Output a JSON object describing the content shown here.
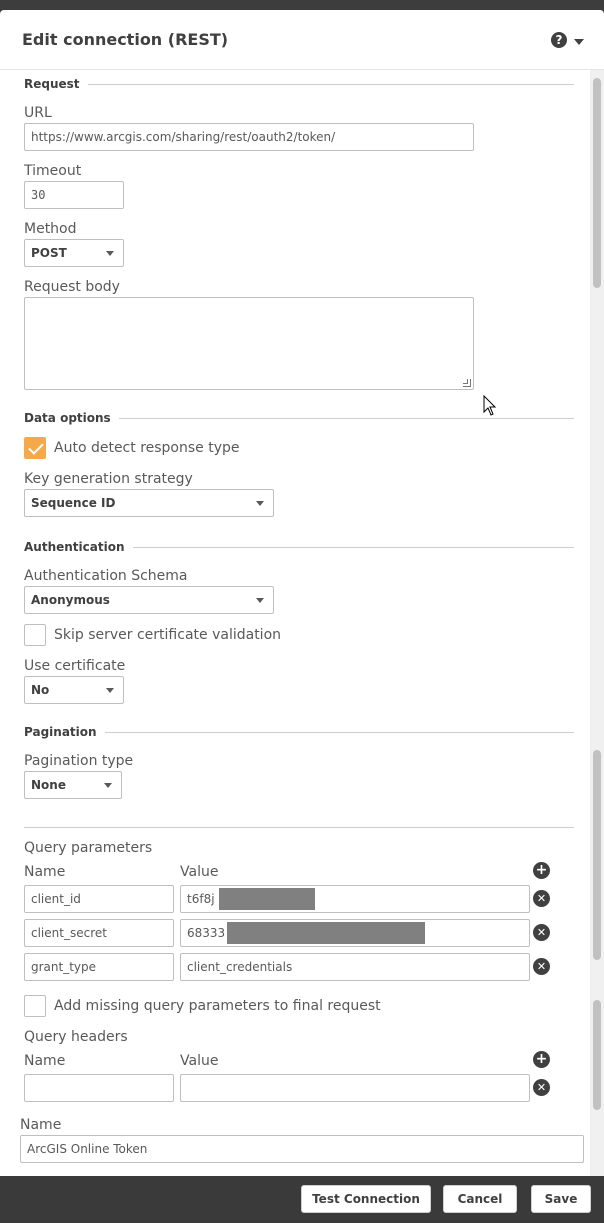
{
  "dialog": {
    "title": "Edit connection (REST)",
    "help_glyph": "?"
  },
  "request": {
    "section": "Request",
    "url_label": "URL",
    "url_value": "https://www.arcgis.com/sharing/rest/oauth2/token/",
    "timeout_label": "Timeout",
    "timeout_value": "30",
    "method_label": "Method",
    "method_value": "POST",
    "body_label": "Request body"
  },
  "data_options": {
    "section": "Data options",
    "auto_detect_label": "Auto detect response type",
    "auto_detect_checked": true,
    "key_strategy_label": "Key generation strategy",
    "key_strategy_value": "Sequence ID"
  },
  "authentication": {
    "section": "Authentication",
    "schema_label": "Authentication Schema",
    "schema_value": "Anonymous",
    "skip_cert_label": "Skip server certificate validation",
    "skip_cert_checked": false,
    "use_cert_label": "Use certificate",
    "use_cert_value": "No"
  },
  "pagination": {
    "section": "Pagination",
    "type_label": "Pagination type",
    "type_value": "None"
  },
  "query_parameters": {
    "title": "Query parameters",
    "name_header": "Name",
    "value_header": "Value",
    "rows": [
      {
        "name": "client_id",
        "value": "t6f8j"
      },
      {
        "name": "client_secret",
        "value": "68333"
      },
      {
        "name": "grant_type",
        "value": "client_credentials"
      }
    ],
    "add_missing_label": "Add missing query parameters to final request",
    "add_missing_checked": false
  },
  "query_headers": {
    "title": "Query headers",
    "name_header": "Name",
    "value_header": "Value",
    "rows": [
      {
        "name": "",
        "value": ""
      }
    ]
  },
  "connection_name": {
    "label": "Name",
    "value": "ArcGIS Online Token"
  },
  "footer": {
    "test_label": "Test Connection",
    "cancel_label": "Cancel",
    "save_label": "Save"
  },
  "icons": {
    "help": "help-circle-icon",
    "add": "plus-circle-icon",
    "remove": "close-circle-icon"
  },
  "colors": {
    "accent": "#f5a94a",
    "frame": "#3a3a3a"
  }
}
